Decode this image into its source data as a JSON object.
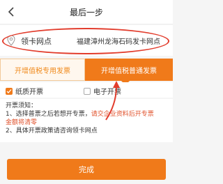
{
  "header": {
    "title": "最后一步",
    "back_icon": "chevron-left-icon"
  },
  "pickup": {
    "label": "领卡网点",
    "value": "福建漳州龙海石码发卡网点",
    "icon": "location-pin-icon"
  },
  "invoice_tabs": {
    "items": [
      {
        "label": "开增值税专用发票",
        "selected": false
      },
      {
        "label": "开增值税普通发票",
        "selected": true
      }
    ]
  },
  "invoice_format": {
    "options": [
      {
        "label": "纸质开票",
        "checked": true
      },
      {
        "label": "电子开票",
        "checked": false
      }
    ]
  },
  "notes": {
    "heading": "开票须知：",
    "line1_prefix": "1、选择普票之后若想开专票，",
    "line1_highlight": "请交企业资料后开专票",
    "line2": "金额将清零",
    "line3": "2、具体开票政策请咨询领卡网点"
  },
  "complete_button": {
    "label": "完成"
  },
  "colors": {
    "accent": "#f07a1a",
    "annotation": "#e23d2d"
  }
}
